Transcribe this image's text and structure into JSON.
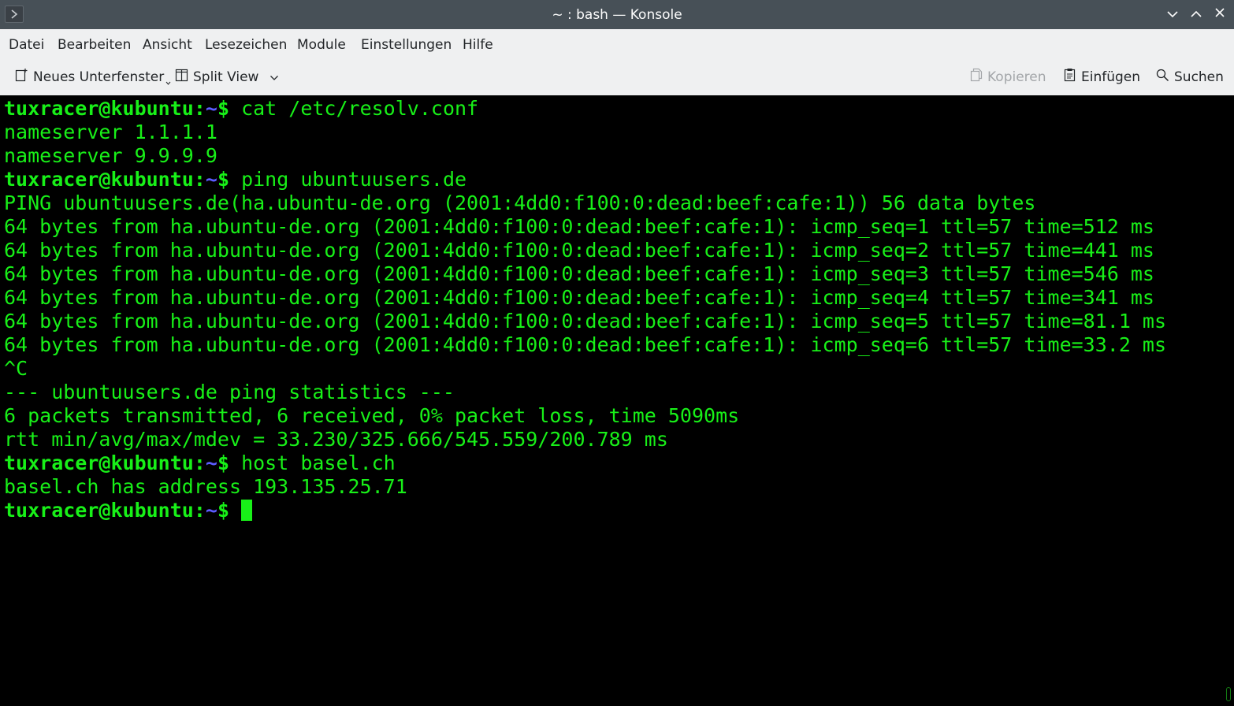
{
  "window": {
    "title": "~ : bash — Konsole"
  },
  "menubar": {
    "items": [
      "Datei",
      "Bearbeiten",
      "Ansicht",
      "Lesezeichen",
      "Module",
      "Einstellungen",
      "Hilfe"
    ]
  },
  "toolbar": {
    "new_tab_label": "Neues Unterfenster",
    "split_view_label": "Split View",
    "copy_label": "Kopieren",
    "paste_label": "Einfügen",
    "search_label": "Suchen"
  },
  "terminal": {
    "prompt": {
      "user_host": "tuxracer@kubuntu",
      "colon": ":",
      "path": "~",
      "dollar": "$"
    },
    "lines": [
      {
        "type": "prompt",
        "command": " cat /etc/resolv.conf"
      },
      {
        "type": "output",
        "text": "nameserver 1.1.1.1"
      },
      {
        "type": "output",
        "text": "nameserver 9.9.9.9"
      },
      {
        "type": "prompt",
        "command": " ping ubuntuusers.de"
      },
      {
        "type": "output",
        "text": "PING ubuntuusers.de(ha.ubuntu-de.org (2001:4dd0:f100:0:dead:beef:cafe:1)) 56 data bytes"
      },
      {
        "type": "output",
        "text": "64 bytes from ha.ubuntu-de.org (2001:4dd0:f100:0:dead:beef:cafe:1): icmp_seq=1 ttl=57 time=512 ms"
      },
      {
        "type": "output",
        "text": "64 bytes from ha.ubuntu-de.org (2001:4dd0:f100:0:dead:beef:cafe:1): icmp_seq=2 ttl=57 time=441 ms"
      },
      {
        "type": "output",
        "text": "64 bytes from ha.ubuntu-de.org (2001:4dd0:f100:0:dead:beef:cafe:1): icmp_seq=3 ttl=57 time=546 ms"
      },
      {
        "type": "output",
        "text": "64 bytes from ha.ubuntu-de.org (2001:4dd0:f100:0:dead:beef:cafe:1): icmp_seq=4 ttl=57 time=341 ms"
      },
      {
        "type": "output",
        "text": "64 bytes from ha.ubuntu-de.org (2001:4dd0:f100:0:dead:beef:cafe:1): icmp_seq=5 ttl=57 time=81.1 ms"
      },
      {
        "type": "output",
        "text": "64 bytes from ha.ubuntu-de.org (2001:4dd0:f100:0:dead:beef:cafe:1): icmp_seq=6 ttl=57 time=33.2 ms"
      },
      {
        "type": "output",
        "text": "^C"
      },
      {
        "type": "output",
        "text": "--- ubuntuusers.de ping statistics ---"
      },
      {
        "type": "output",
        "text": "6 packets transmitted, 6 received, 0% packet loss, time 5090ms"
      },
      {
        "type": "output",
        "text": "rtt min/avg/max/mdev = 33.230/325.666/545.559/200.789 ms"
      },
      {
        "type": "prompt",
        "command": " host basel.ch"
      },
      {
        "type": "output",
        "text": "basel.ch has address 193.135.25.71"
      },
      {
        "type": "prompt",
        "command": " ",
        "cursor": true
      }
    ]
  },
  "colors": {
    "terminal_fg": "#18f018",
    "terminal_bg": "#000000",
    "path_color": "#5c5cff",
    "titlebar_bg": "#475057",
    "menubar_bg": "#eff0f1"
  }
}
